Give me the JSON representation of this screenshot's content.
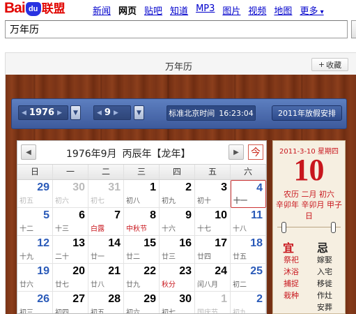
{
  "header": {
    "logo_bai": "Bai",
    "logo_du": "du",
    "logo_lm": "联盟",
    "nav": [
      "新闻",
      "网页",
      "贴吧",
      "知道",
      "MP3",
      "图片",
      "视频",
      "地图",
      "更多"
    ],
    "active_nav": "网页"
  },
  "search": {
    "value": "万年历"
  },
  "result": {
    "title": "万年历",
    "fav_label": "收藏",
    "fav_icon": "plus-icon"
  },
  "toolbar": {
    "year": "1976",
    "month": "9",
    "clock_label": "标准北京时间",
    "clock_time": "16:23:04",
    "holiday_button": "2011年放假安排"
  },
  "calendar": {
    "title_date": "1976年9月",
    "title_ganzhi": "丙辰年【龙年】",
    "today_button": "今",
    "weekdays": [
      "日",
      "一",
      "二",
      "三",
      "四",
      "五",
      "六"
    ],
    "rows": [
      [
        {
          "d": "29",
          "l": "初五",
          "out": true
        },
        {
          "d": "30",
          "l": "初六",
          "out": true
        },
        {
          "d": "31",
          "l": "初七",
          "out": true
        },
        {
          "d": "1",
          "l": "初八"
        },
        {
          "d": "2",
          "l": "初九"
        },
        {
          "d": "3",
          "l": "初十"
        },
        {
          "d": "4",
          "l": "十一",
          "sel": true
        }
      ],
      [
        {
          "d": "5",
          "l": "十二"
        },
        {
          "d": "6",
          "l": "十三"
        },
        {
          "d": "7",
          "l": "白露",
          "hl": true
        },
        {
          "d": "8",
          "l": "中秋节",
          "hl": true
        },
        {
          "d": "9",
          "l": "十六"
        },
        {
          "d": "10",
          "l": "十七"
        },
        {
          "d": "11",
          "l": "十八"
        }
      ],
      [
        {
          "d": "12",
          "l": "十九"
        },
        {
          "d": "13",
          "l": "二十"
        },
        {
          "d": "14",
          "l": "廿一"
        },
        {
          "d": "15",
          "l": "廿二"
        },
        {
          "d": "16",
          "l": "廿三"
        },
        {
          "d": "17",
          "l": "廿四"
        },
        {
          "d": "18",
          "l": "廿五"
        }
      ],
      [
        {
          "d": "19",
          "l": "廿六"
        },
        {
          "d": "20",
          "l": "廿七"
        },
        {
          "d": "21",
          "l": "廿八"
        },
        {
          "d": "22",
          "l": "廿九"
        },
        {
          "d": "23",
          "l": "秋分",
          "hl": true
        },
        {
          "d": "24",
          "l": "闰八月"
        },
        {
          "d": "25",
          "l": "初二"
        }
      ],
      [
        {
          "d": "26",
          "l": "初三"
        },
        {
          "d": "27",
          "l": "初四"
        },
        {
          "d": "28",
          "l": "初五"
        },
        {
          "d": "29",
          "l": "初六"
        },
        {
          "d": "30",
          "l": "初七"
        },
        {
          "d": "1",
          "l": "国庆节",
          "out": true
        },
        {
          "d": "2",
          "l": "初九",
          "out": true
        }
      ]
    ]
  },
  "almanac": {
    "date": "2011-3-10 星期四",
    "day": "10",
    "lunar1": "农历 二月 初六",
    "lunar2": "辛卯年 辛卯月 甲子日",
    "yi_label": "宜",
    "ji_label": "忌",
    "yi_items": [
      "祭祀",
      "沐浴",
      "捕捉",
      "栽种"
    ],
    "ji_items": [
      "嫁娶",
      "入宅",
      "移徙",
      "作灶",
      "安葬"
    ]
  },
  "colors": {
    "brand_red": "#e10602",
    "brand_blue": "#2932e1",
    "toolbar_blue": "#3d5a9c",
    "lunar_red": "#c8161d",
    "weekend_blue": "#2a5ab8"
  }
}
